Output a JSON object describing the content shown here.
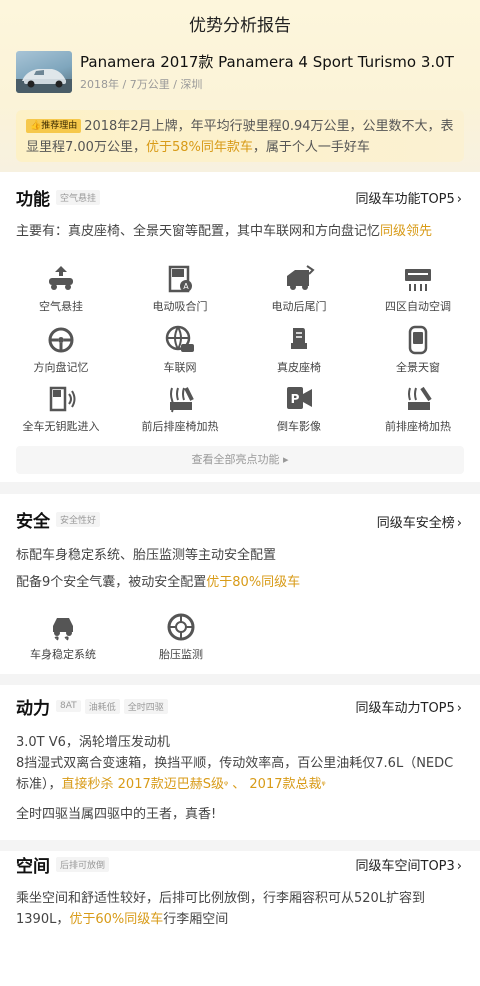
{
  "page": {
    "title": "优势分析报告"
  },
  "car": {
    "name": "Panamera 2017款 Panamera 4 Sport Turismo 3.0T",
    "meta": "2018年 / 7万公里 / 深圳"
  },
  "recommend": {
    "badge": "推荐理由",
    "text_a": "2018年2月上牌，年平均行驶里程0.94万公里，公里数不大，表显里程7.00万公里，",
    "highlight": "优于58%同年款车",
    "text_b": "，属于个人一手好车"
  },
  "features": {
    "title": "功能",
    "tag": "空气悬挂",
    "link": "同级车功能TOP5",
    "summary_a": "主要有：真皮座椅、全景天窗等配置，其中车联网和方向盘记忆",
    "summary_hl": "同级领先",
    "items": [
      {
        "label": "空气悬挂",
        "icon": "air-suspension-icon"
      },
      {
        "label": "电动吸合门",
        "icon": "soft-close-door-icon"
      },
      {
        "label": "电动后尾门",
        "icon": "power-tailgate-icon"
      },
      {
        "label": "四区自动空调",
        "icon": "four-zone-ac-icon"
      },
      {
        "label": "方向盘记忆",
        "icon": "steering-memory-icon"
      },
      {
        "label": "车联网",
        "icon": "connected-car-icon"
      },
      {
        "label": "真皮座椅",
        "icon": "leather-seat-icon"
      },
      {
        "label": "全景天窗",
        "icon": "panoramic-sunroof-icon"
      },
      {
        "label": "全车无钥匙进入",
        "icon": "keyless-entry-icon"
      },
      {
        "label": "前后排座椅加热",
        "icon": "seat-heating-icon"
      },
      {
        "label": "倒车影像",
        "icon": "reverse-camera-icon"
      },
      {
        "label": "前排座椅加热",
        "icon": "front-seat-heating-icon"
      }
    ],
    "view_all": "查看全部亮点功能 ▸"
  },
  "safety": {
    "title": "安全",
    "tag": "安全性好",
    "link": "同级车安全榜",
    "line1": "标配车身稳定系统、胎压监测等主动安全配置",
    "line2_a": "配备9个安全气囊，被动安全配置",
    "line2_hl": "优于80%同级车",
    "items": [
      {
        "label": "车身稳定系统",
        "icon": "stability-control-icon"
      },
      {
        "label": "胎压监测",
        "icon": "tire-pressure-icon"
      }
    ]
  },
  "power": {
    "title": "动力",
    "tags": [
      "8AT",
      "油耗低",
      "全时四驱"
    ],
    "link": "同级车动力TOP5",
    "line1": "3.0T V6，涡轮增压发动机",
    "para_a": "8挡湿式双离合变速箱，换挡平顺，传动效率高，百公里油耗仅7.6L（NEDC标准），",
    "para_hl1": "直接秒杀 2017款迈巴赫S级",
    "para_mid": " 、 ",
    "para_hl2": "2017款总裁",
    "line3": "全时四驱当属四驱中的王者，真香!"
  },
  "space": {
    "title": "空间",
    "tag": "后排可放倒",
    "link": "同级车空间TOP3",
    "para_a": "乘坐空间和舒适性较好，后排可比例放倒，行李厢容积可从520L扩容到1390L，",
    "para_hl": "优于60%同级车",
    "para_b": "行李厢空间"
  },
  "colors": {
    "accent": "#d89b18",
    "badge": "#f6c84b"
  }
}
